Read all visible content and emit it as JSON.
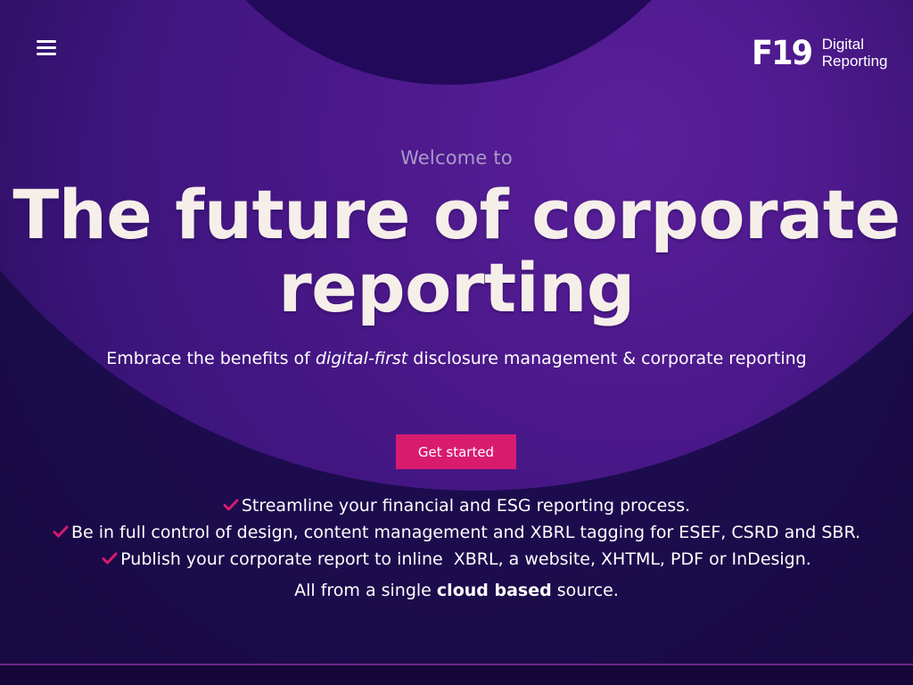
{
  "header": {
    "menu_icon": "hamburger-menu-icon",
    "logo": {
      "mark": "F19",
      "line1": "Digital",
      "line2": "Reporting"
    }
  },
  "hero": {
    "welcome": "Welcome to",
    "headline_line1": "The future of corporate",
    "headline_line2": "reporting",
    "subhead_pre": "Embrace the benefits of ",
    "subhead_em": "digital-first",
    "subhead_post": " disclosure management & corporate reporting",
    "cta_label": "Get started"
  },
  "features": [
    "Streamline your financial and ESG reporting process.",
    "Be in full control of design, content management and XBRL tagging for ESEF, CSRD and SBR.",
    "Publish your corporate report to inline  XBRL, a website, XHTML, PDF or InDesign."
  ],
  "tagline": {
    "pre": "All from a single ",
    "strong": "cloud based",
    "post": " source."
  },
  "colors": {
    "background": "#1c0c4d",
    "accent": "#d81b6f",
    "headline": "#f6efe9",
    "welcome": "#a99bc9"
  },
  "icons": {
    "feature_bullet": "checkmark-icon"
  }
}
